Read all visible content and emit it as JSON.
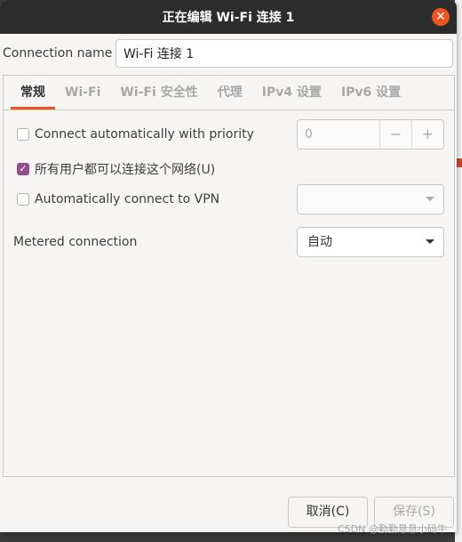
{
  "window": {
    "title": "正在编辑 Wi-Fi 连接 1"
  },
  "connection_name": {
    "label": "Connection name",
    "value": "Wi-Fi 连接 1"
  },
  "tabs": [
    {
      "label": "常规",
      "active": true
    },
    {
      "label": "Wi-Fi"
    },
    {
      "label": "Wi-Fi 安全性"
    },
    {
      "label": "代理"
    },
    {
      "label": "IPv4 设置"
    },
    {
      "label": "IPv6 设置"
    }
  ],
  "general": {
    "auto_connect": {
      "label": "Connect automatically with priority",
      "checked": false,
      "priority": "0",
      "minus": "−",
      "plus": "+"
    },
    "all_users": {
      "label": "所有用户都可以连接这个网络(U)",
      "checked": true
    },
    "auto_vpn": {
      "label": "Automatically connect to VPN",
      "checked": false,
      "value": ""
    },
    "metered": {
      "label": "Metered connection",
      "value": "自动"
    }
  },
  "buttons": {
    "cancel": "取消(C)",
    "save": "保存(S)"
  },
  "watermark": "CSDN @勤勤恳恳小码牛",
  "colors": {
    "accent": "#e95420",
    "checkbox": "#924d8b",
    "titlebar": "#2c2c2c"
  }
}
